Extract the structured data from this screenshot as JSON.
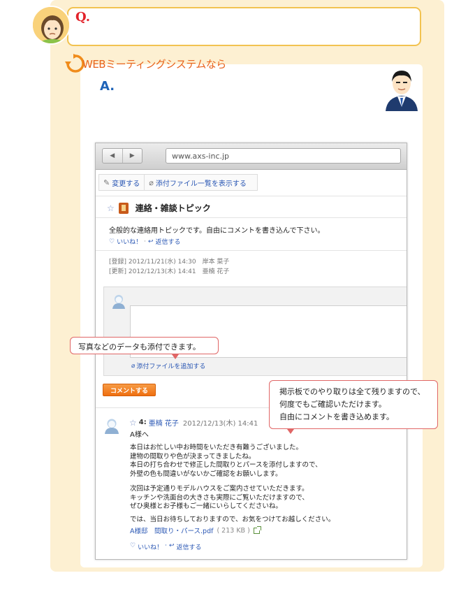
{
  "question": {
    "label": "Q.",
    "text": ""
  },
  "answer": {
    "intro": "WEBミーティングシステムなら",
    "label": "A."
  },
  "browser": {
    "back": "◀",
    "forward": "▶",
    "url": "www.axs-inc.jp"
  },
  "toolbar": {
    "edit": "変更する",
    "attachments": "添付ファイル一覧を表示する"
  },
  "topic": {
    "title": "連絡・雑談トピック",
    "description": "全般的な連絡用トピックです。自由にコメントを書き込んで下さい。",
    "like": "いいね！",
    "reply": "返信する",
    "registered": "[登録] 2012/11/21(水) 14:30　岸本 菜子",
    "updated": "[更新] 2012/12/13(木) 14:41　亜楠 花子"
  },
  "comment_form": {
    "attach_link": "添付ファイルを追加する",
    "submit": "コメントする"
  },
  "post": {
    "number": "4:",
    "author": "亜楠 花子",
    "date": "2012/12/13(木) 14:41",
    "to": "A様へ",
    "p1": [
      "本日はお忙しい中お時間をいただき有難うございました。",
      "建物の間取りや色が決まってきましたね。",
      "本日の打ち合わせで修正した間取りとパースを添付しますので、",
      "外壁の色も間違いがないかご確認をお願いします。"
    ],
    "p2": [
      "次回は予定通りモデルハウスをご案内させていただきます。",
      "キッチンや洗面台の大きさも実際にご覧いただけますので、",
      "ぜひ奥様とお子様もご一緒にいらしてくださいね。"
    ],
    "p3": "では、当日お待ちしておりますので、お気をつけてお越しください。",
    "file_name": "A様邸　間取り・パース.pdf",
    "file_size": "( 213 KB )",
    "like": "いいね！",
    "reply": "返信する"
  },
  "callouts": {
    "attach": "写真などのデータも添付できます。",
    "board": [
      "掲示板でのやり取りは全て残りますので、",
      "何度でもご確認いただけます。",
      "自由にコメントを書き込めます。"
    ]
  },
  "colors": {
    "accent": "#ef6f10",
    "link": "#2a57b4",
    "question": "#e2222a",
    "answer": "#1e63b8",
    "panel": "#fdf0d2"
  }
}
